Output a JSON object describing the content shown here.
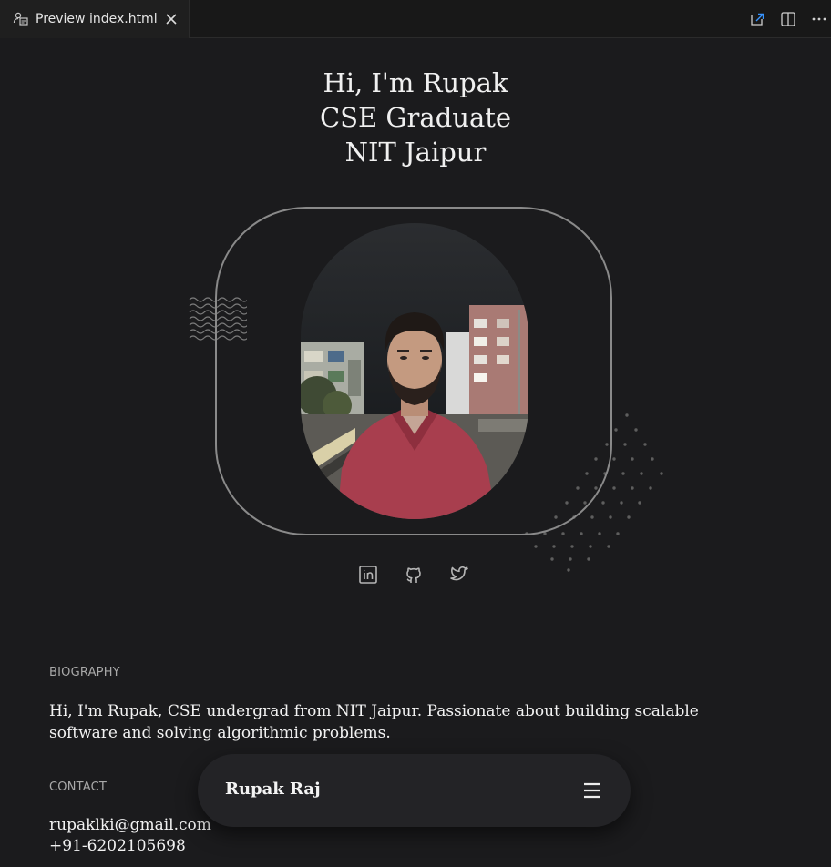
{
  "tab": {
    "title": "Preview index.html",
    "icon": "preview-icon",
    "close_icon": "close-icon"
  },
  "tab_actions": [
    {
      "icon": "open-in-editor-icon"
    },
    {
      "icon": "split-editor-icon"
    },
    {
      "icon": "more-actions-icon"
    }
  ],
  "hero": {
    "line1": "Hi, I'm Rupak",
    "line2": "CSE Graduate",
    "line3": "NIT Jaipur"
  },
  "profile": {
    "photo": "profile-photo"
  },
  "social": [
    {
      "icon": "linkedin-icon"
    },
    {
      "icon": "github-icon"
    },
    {
      "icon": "twitter-icon"
    }
  ],
  "biography": {
    "heading": "BIOGRAPHY",
    "text": "Hi, I'm Rupak, CSE undergrad from NIT Jaipur. Passionate about building scalable software and solving algorithmic problems."
  },
  "contact": {
    "heading": "CONTACT",
    "email": "rupaklki@gmail.com",
    "phone": "+91-6202105698"
  },
  "navbar": {
    "brand": "Rupak Raj",
    "menu_icon": "hamburger-menu-icon"
  },
  "colors": {
    "background": "#1b1b1d",
    "navbar": "#232326",
    "accent_shirt": "#a83e4e"
  }
}
